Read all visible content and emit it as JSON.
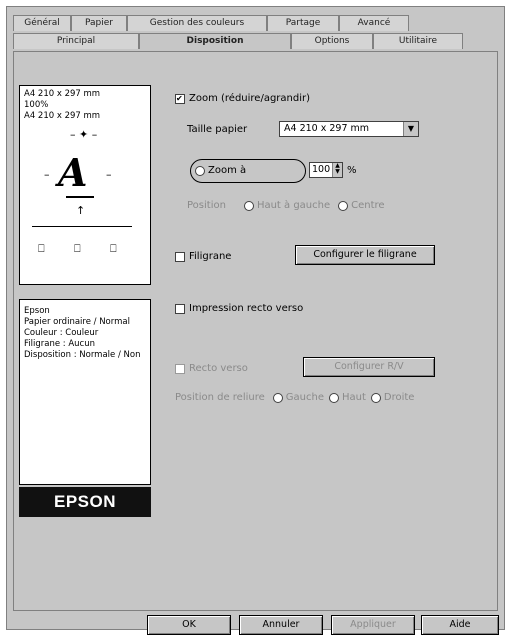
{
  "tabs_top": [
    "Général",
    "Papier",
    "Gestion des couleurs",
    "Partage",
    "Avancé"
  ],
  "tabs_bottom": [
    "Principal",
    "Disposition",
    "Options",
    "Utilitaire"
  ],
  "preview": {
    "line1": "A4 210 x 297 mm",
    "line2": "100%",
    "line3": "A4 210 x 297 mm",
    "letter": "A"
  },
  "info_lines": [
    "Epson",
    "Papier ordinaire / Normal",
    "Couleur : Couleur",
    "Filigrane : Aucun",
    "Disposition : Normale / Non"
  ],
  "logo": "EPSON",
  "controls": {
    "zoom_option_label": "Zoom (réduire/agrandir)",
    "paper_size_label": "Taille papier",
    "paper_size_value": "A4 210 x 297 mm",
    "zoom_percent_label": "Zoom à",
    "zoom_percent_value": "100",
    "percent_unit": "%",
    "position_label": "Position",
    "position_opt1": "Haut à gauche",
    "position_opt2": "Centre",
    "filigrane_label": "Filigrane",
    "filigrane_button": "Configurer le filigrane",
    "print_mode_label": "Impression recto verso",
    "recto_verso_label": "Recto verso",
    "recto_verso_button": "Configurer R/V",
    "binding_label": "Position de reliure",
    "binding_opt1": "Gauche",
    "binding_opt2": "Haut",
    "binding_opt3": "Droite"
  },
  "footer": {
    "ok": "OK",
    "cancel": "Annuler",
    "apply": "Appliquer",
    "help": "Aide"
  }
}
